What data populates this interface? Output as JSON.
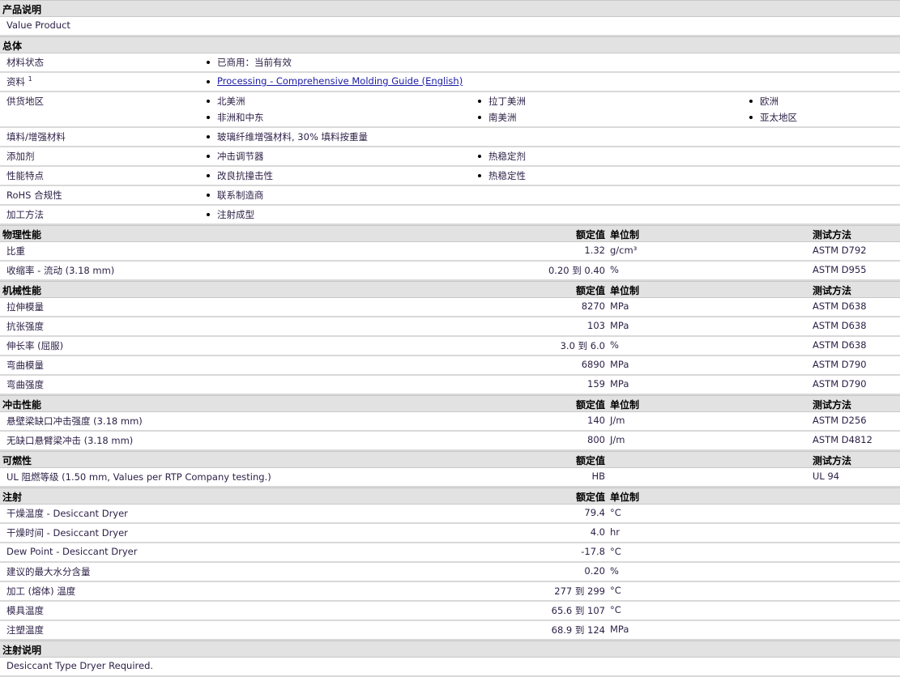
{
  "sections": [
    {
      "title": "产品说明",
      "rows": [
        {
          "label": "Value Product"
        }
      ]
    },
    {
      "title": "总体",
      "rows": [
        {
          "label": "材料状态",
          "items": [
            "已商用：当前有效"
          ]
        },
        {
          "label": "资料",
          "sup": "1",
          "link": "Processing - Comprehensive Molding Guide (English)"
        },
        {
          "label": "供货地区",
          "items": [
            "北美洲",
            "拉丁美洲",
            "欧洲",
            "非洲和中东",
            "南美洲",
            "亚太地区"
          ],
          "tall": true
        },
        {
          "label": "填料/增强材料",
          "items": [
            "玻璃纤维增强材料, 30% 填料按重量"
          ]
        },
        {
          "label": "添加剂",
          "items": [
            "冲击调节器",
            "热稳定剂"
          ]
        },
        {
          "label": "性能特点",
          "items": [
            "改良抗撞击性",
            "热稳定性"
          ]
        },
        {
          "label": "RoHS 合规性",
          "items": [
            "联系制造商"
          ]
        },
        {
          "label": "加工方法",
          "items": [
            "注射成型"
          ]
        }
      ]
    },
    {
      "title": "物理性能",
      "h_val": "额定值",
      "h_unit": "单位制",
      "h_test": "测试方法",
      "rows": [
        {
          "label": "比重",
          "value": "1.32",
          "unit": "g/cm³",
          "test": "ASTM D792"
        },
        {
          "label": "收缩率 - 流动 (3.18 mm)",
          "value": "0.20 到 0.40",
          "unit": "%",
          "test": "ASTM D955"
        }
      ]
    },
    {
      "title": "机械性能",
      "h_val": "额定值",
      "h_unit": "单位制",
      "h_test": "测试方法",
      "rows": [
        {
          "label": "拉伸模量",
          "value": "8270",
          "unit": "MPa",
          "test": "ASTM D638"
        },
        {
          "label": "抗张强度",
          "value": "103",
          "unit": "MPa",
          "test": "ASTM D638"
        },
        {
          "label": "伸长率 (屈服)",
          "value": "3.0 到 6.0",
          "unit": "%",
          "test": "ASTM D638"
        },
        {
          "label": "弯曲模量",
          "value": "6890",
          "unit": "MPa",
          "test": "ASTM D790"
        },
        {
          "label": "弯曲强度",
          "value": "159",
          "unit": "MPa",
          "test": "ASTM D790"
        }
      ]
    },
    {
      "title": "冲击性能",
      "h_val": "额定值",
      "h_unit": "单位制",
      "h_test": "测试方法",
      "rows": [
        {
          "label": "悬壁梁缺口冲击强度 (3.18 mm)",
          "value": "140",
          "unit": "J/m",
          "test": "ASTM D256"
        },
        {
          "label": "无缺口悬臂梁冲击 (3.18 mm)",
          "value": "800",
          "unit": "J/m",
          "test": "ASTM D4812"
        }
      ]
    },
    {
      "title": "可燃性",
      "h_val": "额定值",
      "h_test": "测试方法",
      "rows": [
        {
          "label": "UL 阻燃等级 (1.50 mm, Values per RTP Company testing.)",
          "value": "HB",
          "test": "UL 94"
        }
      ]
    },
    {
      "title": "注射",
      "h_val": "额定值",
      "h_unit": "单位制",
      "rows": [
        {
          "label": "干燥温度 - Desiccant Dryer",
          "value": "79.4",
          "unit": "°C"
        },
        {
          "label": "干燥时间 - Desiccant Dryer",
          "value": "4.0",
          "unit": "hr"
        },
        {
          "label": "Dew Point - Desiccant Dryer",
          "value": "-17.8",
          "unit": "°C"
        },
        {
          "label": "建议的最大水分含量",
          "value": "0.20",
          "unit": "%"
        },
        {
          "label": "加工 (熔体) 温度",
          "value": "277 到 299",
          "unit": "°C"
        },
        {
          "label": "模具温度",
          "value": "65.6 到 107",
          "unit": "°C"
        },
        {
          "label": "注塑温度",
          "value": "68.9 到 124",
          "unit": "MPa"
        }
      ]
    },
    {
      "title": "注射说明",
      "rows": [
        {
          "label": "Desiccant Type Dryer Required."
        }
      ]
    }
  ]
}
